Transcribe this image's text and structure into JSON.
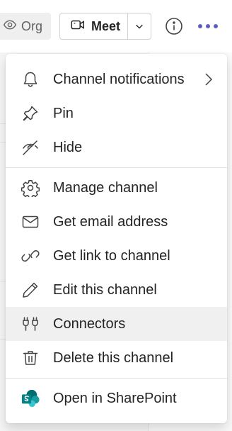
{
  "header": {
    "org_label": "Org",
    "meet_label": "Meet"
  },
  "menu": {
    "group1": [
      {
        "label": "Channel notifications",
        "icon": "bell-icon",
        "has_submenu": true
      },
      {
        "label": "Pin",
        "icon": "pin-icon"
      },
      {
        "label": "Hide",
        "icon": "eye-off-icon"
      }
    ],
    "group2": [
      {
        "label": "Manage channel",
        "icon": "gear-icon"
      },
      {
        "label": "Get email address",
        "icon": "mail-icon"
      },
      {
        "label": "Get link to channel",
        "icon": "link-icon"
      },
      {
        "label": "Edit this channel",
        "icon": "pencil-icon"
      },
      {
        "label": "Connectors",
        "icon": "plug-icon",
        "hovered": true
      },
      {
        "label": "Delete this channel",
        "icon": "trash-icon"
      }
    ],
    "group3": [
      {
        "label": "Open in SharePoint",
        "icon": "sharepoint-icon"
      }
    ]
  },
  "colors": {
    "accent": "#5b5fc7",
    "sharepoint": "#038387",
    "hover_bg": "#f0f0f0"
  }
}
